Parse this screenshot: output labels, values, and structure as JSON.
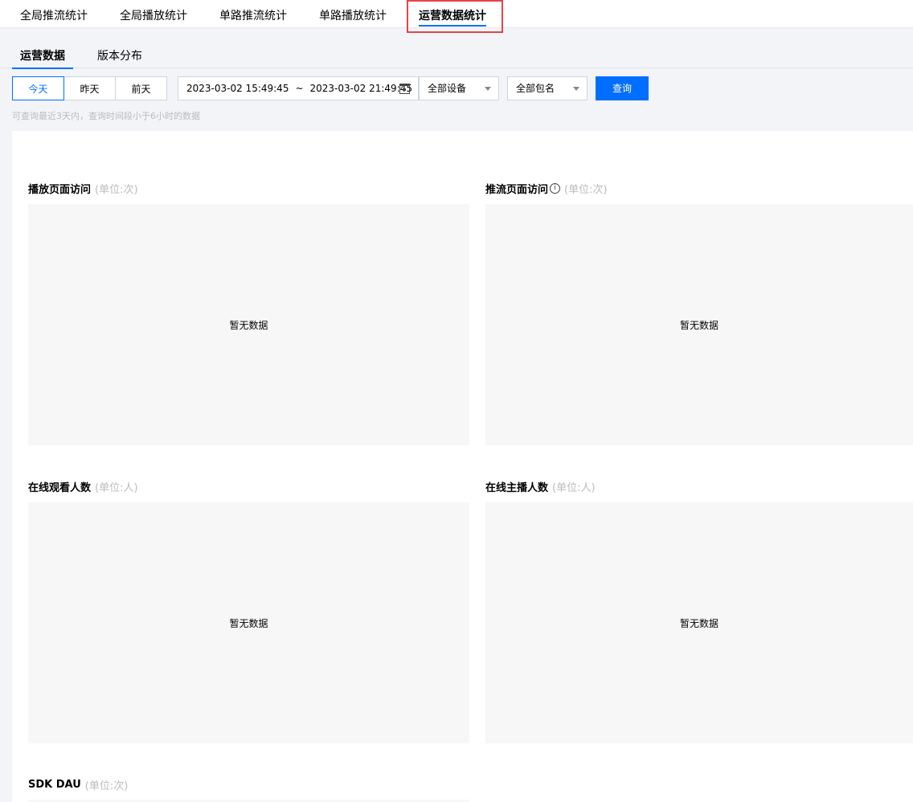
{
  "top_tabs": [
    "全局推流统计",
    "全局播放统计",
    "单路推流统计",
    "单路播放统计",
    "运营数据统计"
  ],
  "sub_tabs": [
    "运营数据",
    "版本分布"
  ],
  "filters": {
    "days": [
      "今天",
      "昨天",
      "前天"
    ],
    "date_start": "2023-03-02 15:49:45",
    "date_sep": "~",
    "date_end": "2023-03-02 21:49:45",
    "device_select": "全部设备",
    "package_select": "全部包名",
    "query_label": "查询",
    "hint": "可查询最近3天内，查询时间段小于6小时的数据"
  },
  "cards": [
    {
      "title": "播放页面访问",
      "unit": "(单位:次)",
      "empty": "暂无数据"
    },
    {
      "title": "推流页面访问",
      "info": "i",
      "unit": "(单位:次)",
      "empty": "暂无数据"
    },
    {
      "title": "在线观看人数",
      "unit": "(单位:人)",
      "empty": "暂无数据"
    },
    {
      "title": "在线主播人数",
      "unit": "(单位:人)",
      "empty": "暂无数据"
    },
    {
      "title": "SDK DAU",
      "unit": "(单位:次)"
    }
  ],
  "colors": {
    "accent": "#006eff",
    "highlight": "#e54545"
  }
}
